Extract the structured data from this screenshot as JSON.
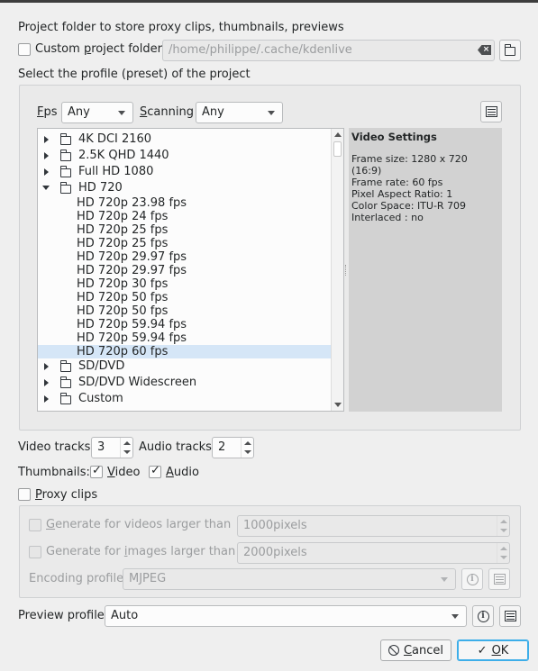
{
  "project_folder": {
    "heading": "Project folder to store proxy clips, thumbnails, previews",
    "custom_folder_label": "Custom project folder",
    "custom_folder_checked": false,
    "path_placeholder": "/home/philippe/.cache/kdenlive"
  },
  "profile": {
    "heading": "Select the profile (preset) of the project",
    "fps_label": "Fps",
    "fps_value": "Any",
    "scanning_label": "Scanning",
    "scanning_value": "Any",
    "tree": [
      {
        "label": "4K DCI 2160",
        "type": "folder",
        "expanded": false
      },
      {
        "label": "2.5K QHD 1440",
        "type": "folder",
        "expanded": false
      },
      {
        "label": "Full HD 1080",
        "type": "folder",
        "expanded": false
      },
      {
        "label": "HD 720",
        "type": "folder",
        "expanded": true
      },
      {
        "label": "HD 720p 23.98 fps",
        "type": "item"
      },
      {
        "label": "HD 720p 24 fps",
        "type": "item"
      },
      {
        "label": "HD 720p 25 fps",
        "type": "item"
      },
      {
        "label": "HD 720p 25 fps",
        "type": "item"
      },
      {
        "label": "HD 720p 29.97 fps",
        "type": "item"
      },
      {
        "label": "HD 720p 29.97 fps",
        "type": "item"
      },
      {
        "label": "HD 720p 30 fps",
        "type": "item"
      },
      {
        "label": "HD 720p 50 fps",
        "type": "item"
      },
      {
        "label": "HD 720p 50 fps",
        "type": "item"
      },
      {
        "label": "HD 720p 59.94 fps",
        "type": "item"
      },
      {
        "label": "HD 720p 59.94 fps",
        "type": "item"
      },
      {
        "label": "HD 720p 60 fps",
        "type": "item",
        "selected": true
      },
      {
        "label": "SD/DVD",
        "type": "folder",
        "expanded": false
      },
      {
        "label": "SD/DVD Widescreen",
        "type": "folder",
        "expanded": false
      },
      {
        "label": "Custom",
        "type": "folder",
        "expanded": false
      }
    ],
    "video_settings": {
      "title": "Video Settings",
      "frame_size": "Frame size: 1280 x 720 (16:9)",
      "frame_rate": "Frame rate: 60 fps",
      "pixel_aspect": "Pixel Aspect Ratio: 1",
      "color_space": "Color Space: ITU-R 709",
      "interlaced": "Interlaced : no"
    }
  },
  "tracks": {
    "video_label": "Video tracks",
    "video_value": "3",
    "audio_label": "Audio tracks",
    "audio_value": "2"
  },
  "thumbnails": {
    "label": "Thumbnails:",
    "video_label": "Video",
    "video_checked": true,
    "audio_label": "Audio",
    "audio_checked": true
  },
  "proxy": {
    "label": "Proxy clips",
    "checked": false,
    "gen_videos_label": "Generate for videos larger than",
    "gen_videos_value": "1000pixels",
    "gen_images_label": "Generate for images larger than",
    "gen_images_value": "2000pixels",
    "encoding_label": "Encoding profile",
    "encoding_value": "MJPEG"
  },
  "preview": {
    "label": "Preview profile",
    "value": "Auto"
  },
  "buttons": {
    "cancel": "Cancel",
    "ok": "OK"
  },
  "icons": {
    "check": "✓",
    "info": "i",
    "cancel": "⃠"
  }
}
